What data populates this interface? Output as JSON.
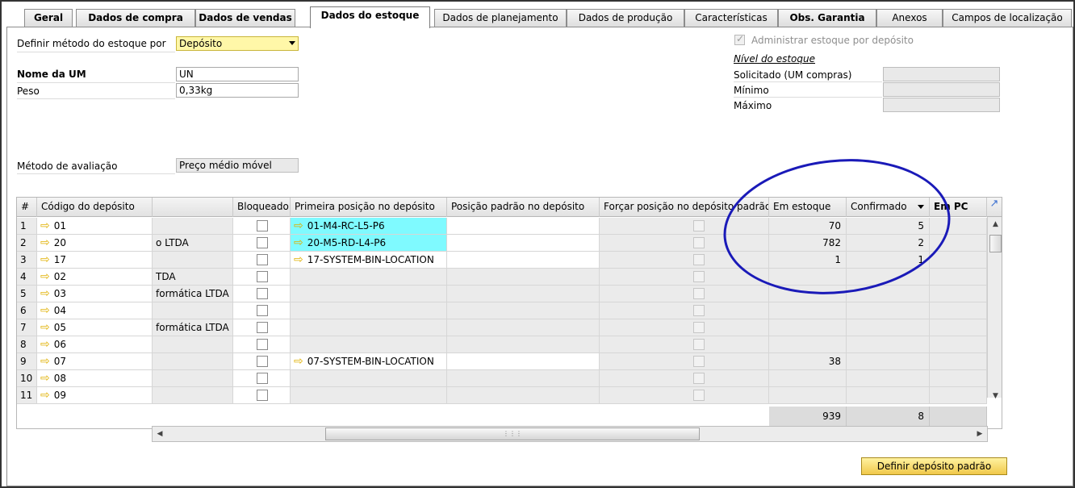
{
  "tabs": [
    {
      "label": "Geral"
    },
    {
      "label": "Dados de compra"
    },
    {
      "label": "Dados de vendas"
    },
    {
      "label": "Dados do estoque"
    },
    {
      "label": "Dados de planejamento"
    },
    {
      "label": "Dados de produção"
    },
    {
      "label": "Características"
    },
    {
      "label": "Obs. Garantia"
    },
    {
      "label": "Anexos"
    },
    {
      "label": "Campos de localização"
    }
  ],
  "form": {
    "method_label": "Definir método do estoque por",
    "method_value": "Depósito",
    "uom_label": "Nome da UM",
    "uom_value": "UN",
    "weight_label": "Peso",
    "weight_value": "0,33kg",
    "valuation_label": "Método de avaliação",
    "valuation_value": "Preço médio móvel"
  },
  "stock_level": {
    "manage_label": "Administrar estoque por depósito",
    "manage_checked": true,
    "title": "Nível do estoque",
    "requested_label": "Solicitado (UM compras)",
    "min_label": "Mínimo",
    "max_label": "Máximo"
  },
  "grid": {
    "headers": {
      "num": "#",
      "code": "Código do depósito",
      "name": "",
      "locked": "Bloqueado",
      "first_bin": "Primeira posição no depósito",
      "default_bin": "Posição padrão no depósito",
      "force_bin": "Forçar posição no depósito padrão",
      "in_stock": "Em estoque",
      "committed": "Confirmado",
      "ordered": "Em PC"
    },
    "rows": [
      {
        "n": "1",
        "code": "01",
        "name": "",
        "first_bin": "01-M4-RC-L5-P6",
        "in_stock": "70",
        "committed": "5"
      },
      {
        "n": "2",
        "code": "20",
        "name": "o LTDA",
        "first_bin": "20-M5-RD-L4-P6",
        "in_stock": "782",
        "committed": "2"
      },
      {
        "n": "3",
        "code": "17",
        "name": "",
        "first_bin": "17-SYSTEM-BIN-LOCATION",
        "in_stock": "1",
        "committed": "1"
      },
      {
        "n": "4",
        "code": "02",
        "name": "TDA",
        "first_bin": "",
        "in_stock": "",
        "committed": ""
      },
      {
        "n": "5",
        "code": "03",
        "name": "formática LTDA",
        "first_bin": "",
        "in_stock": "",
        "committed": ""
      },
      {
        "n": "6",
        "code": "04",
        "name": "",
        "first_bin": "",
        "in_stock": "",
        "committed": ""
      },
      {
        "n": "7",
        "code": "05",
        "name": "formática LTDA",
        "first_bin": "",
        "in_stock": "",
        "committed": ""
      },
      {
        "n": "8",
        "code": "06",
        "name": "",
        "first_bin": "",
        "in_stock": "",
        "committed": ""
      },
      {
        "n": "9",
        "code": "07",
        "name": "",
        "first_bin": "07-SYSTEM-BIN-LOCATION",
        "in_stock": "38",
        "committed": ""
      },
      {
        "n": "10",
        "code": "08",
        "name": "",
        "first_bin": "",
        "in_stock": "",
        "committed": ""
      },
      {
        "n": "11",
        "code": "09",
        "name": "",
        "first_bin": "",
        "in_stock": "",
        "committed": ""
      }
    ],
    "totals": {
      "in_stock": "939",
      "committed": "8"
    }
  },
  "buttons": {
    "default_warehouse": "Definir depósito padrão"
  },
  "colors": {
    "highlight_cyan": "#7ffaff",
    "annotation_circle": "#1a1ab8",
    "button_yellow": "#f0c84a"
  },
  "icons": [
    "link-arrow-icon",
    "expand-icon",
    "dropdown-arrow-icon",
    "scroll-up-icon",
    "scroll-down-icon",
    "scroll-left-icon",
    "scroll-right-icon"
  ]
}
